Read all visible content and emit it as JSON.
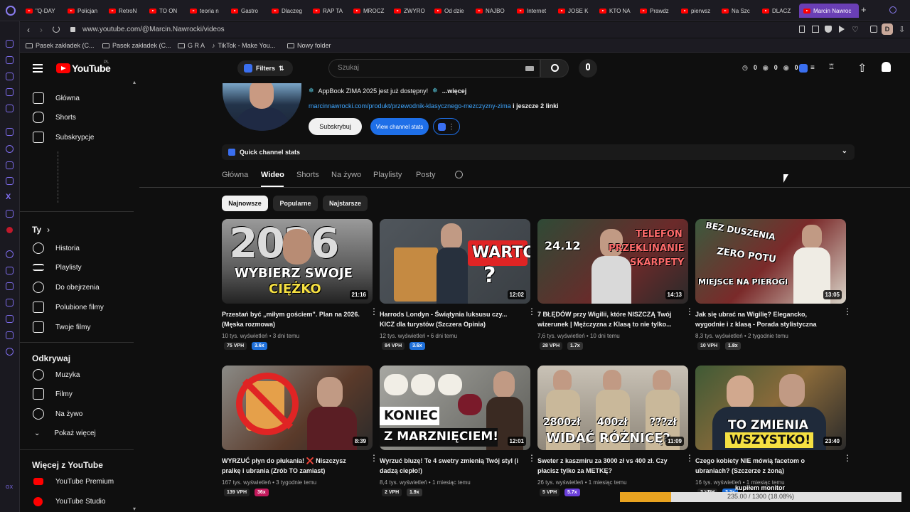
{
  "browser": {
    "tabs": [
      "\"Q-DAY",
      "Policjan",
      "RetroN",
      "TO ON",
      "teoria n",
      "Gastro",
      "Dlaczeg",
      "RAP TA",
      "MROCZ",
      "ZWYRO",
      "Od dzie",
      "NAJBO",
      "Internet",
      "JOSE K",
      "KTO NA",
      "Prawdz",
      "pierwsz",
      "Na Szc",
      "DLACZ"
    ],
    "active_tab": "Marcin Nawroc",
    "url": "www.youtube.com/@Marcin.Nawrocki/videos",
    "profile_letter": "D",
    "bookmarks": [
      "Pasek zakładek (C...",
      "Pasek zakładek (C...",
      "G R A",
      "TikTok - Make You...",
      "Nowy folder"
    ]
  },
  "masthead": {
    "logo_text": "YouTube",
    "logo_suffix": "PL",
    "filters_label": "Filters",
    "search_placeholder": "Szukaj",
    "stats": [
      "0",
      "0",
      "0"
    ]
  },
  "sidebar": {
    "top": [
      "Główna",
      "Shorts",
      "Subskrypcje"
    ],
    "you_header": "Ty",
    "you": [
      "Historia",
      "Playlisty",
      "Do obejrzenia",
      "Polubione filmy",
      "Twoje filmy"
    ],
    "explore_header": "Odkrywaj",
    "explore": [
      "Muzyka",
      "Filmy",
      "Na żywo",
      "Pokaż więcej"
    ],
    "more_header": "Więcej z YouTube",
    "more": [
      "YouTube Premium",
      "YouTube Studio"
    ]
  },
  "channel": {
    "promo": "AppBook ZIMA 2025 jest już dostępny!",
    "promo_more": "...więcej",
    "link": "marcinnawrocki.com/produkt/przewodnik-klasycznego-mezczyzny-zima",
    "link_more": "i jeszcze 2 linki",
    "subscribe": "Subskrybuj",
    "view_stats": "View channel stats",
    "quick_stats": "Quick channel stats",
    "tabs": [
      "Główna",
      "Wideo",
      "Shorts",
      "Na żywo",
      "Playlisty",
      "Posty"
    ],
    "selected_tab": "Wideo",
    "chips": [
      "Najnowsze",
      "Popularne",
      "Najstarsze"
    ]
  },
  "videos": [
    {
      "thumb_text": [
        "2026",
        "WYBIERZ SWOJE",
        "CIĘŻKO"
      ],
      "duration": "21:16",
      "title": "Przestań być „miłym gościem\". Plan na 2026. (Męska rozmowa)",
      "views": "10 tys. wyświetleń",
      "age": "3 dni temu",
      "vph": "75 VPH",
      "mult": "3.6x",
      "mult_color": "#1e6fd9"
    },
    {
      "thumb_text": [
        "WARTO",
        "?"
      ],
      "duration": "12:02",
      "title": "Harrods Londyn - Świątynia luksusu czy... KICZ dla turystów (Szczera Opinia)",
      "views": "12 tys. wyświetleń",
      "age": "6 dni temu",
      "vph": "84 VPH",
      "mult": "3.6x",
      "mult_color": "#1e6fd9"
    },
    {
      "thumb_text": [
        "24.12",
        "TELEFON",
        "PRZEKLINANIE",
        "SKARPETY"
      ],
      "duration": "14:13",
      "title": "7 BŁĘDÓW przy Wigilii, które NISZCZĄ Twój wizerunek | Mężczyzna z Klasą to nie tylko...",
      "views": "7,6 tys. wyświetleń",
      "age": "10 dni temu",
      "vph": "28 VPH",
      "mult": "1.7x",
      "mult_color": "#333333"
    },
    {
      "thumb_text": [
        "BEZ DUSZENIA",
        "ZERO POTU",
        "MIEJSCE NA PIEROGI"
      ],
      "duration": "13:05",
      "title": "Jak się ubrać na Wigilię? Elegancko, wygodnie i z klasą - Porada stylistyczna",
      "views": "8,3 tys. wyświetleń",
      "age": "2 tygodnie temu",
      "vph": "10 VPH",
      "mult": "1.8x",
      "mult_color": "#333333"
    },
    {
      "thumb_text": [],
      "duration": "8:39",
      "title": "WYRZUĆ płyn do płukania! ❌ Niszczysz pralkę i ubrania (Zrób TO zamiast)",
      "views": "167 tys. wyświetleń",
      "age": "3 tygodnie temu",
      "vph": "139 VPH",
      "mult": "36x",
      "mult_color": "#c2185b"
    },
    {
      "thumb_text": [
        "KONIEC",
        "Z MARZNIĘCIEM!"
      ],
      "duration": "12:01",
      "title": "Wyrzuć bluzę! Te 4 swetry zmienią Twój styl (i dadzą ciepło!)",
      "views": "8,4 tys. wyświetleń",
      "age": "1 miesiąc temu",
      "vph": "2 VPH",
      "mult": "1.9x",
      "mult_color": "#333333"
    },
    {
      "thumb_text": [
        "2800zł",
        "400zł",
        "???zł",
        "WIDAĆ RÓŻNICĘ?"
      ],
      "duration": "11:09",
      "title": "Sweter z kaszmiru za 3000 zł vs 400 zł. Czy płacisz tylko za METKĘ?",
      "views": "26 tys. wyświetleń",
      "age": "1 miesiąc temu",
      "vph": "5 VPH",
      "mult": "5.7x",
      "mult_color": "#6a3fd9"
    },
    {
      "thumb_text": [
        "TO ZMIENIA",
        "WSZYSTKO!"
      ],
      "duration": "23:40",
      "title": "Czego kobiety NIE mówią facetom o ubraniach? (Szczerze z żoną)",
      "views": "16 tys. wyświetleń",
      "age": "1 miesiąc temu",
      "vph": "2 VPH",
      "mult": "2.2x",
      "mult_color": "#1e6fd9"
    }
  ],
  "overlay": {
    "label": "kupiłem monitor",
    "progress_text": "235.00 / 1300 (18.08%)",
    "progress": 0.1808
  }
}
